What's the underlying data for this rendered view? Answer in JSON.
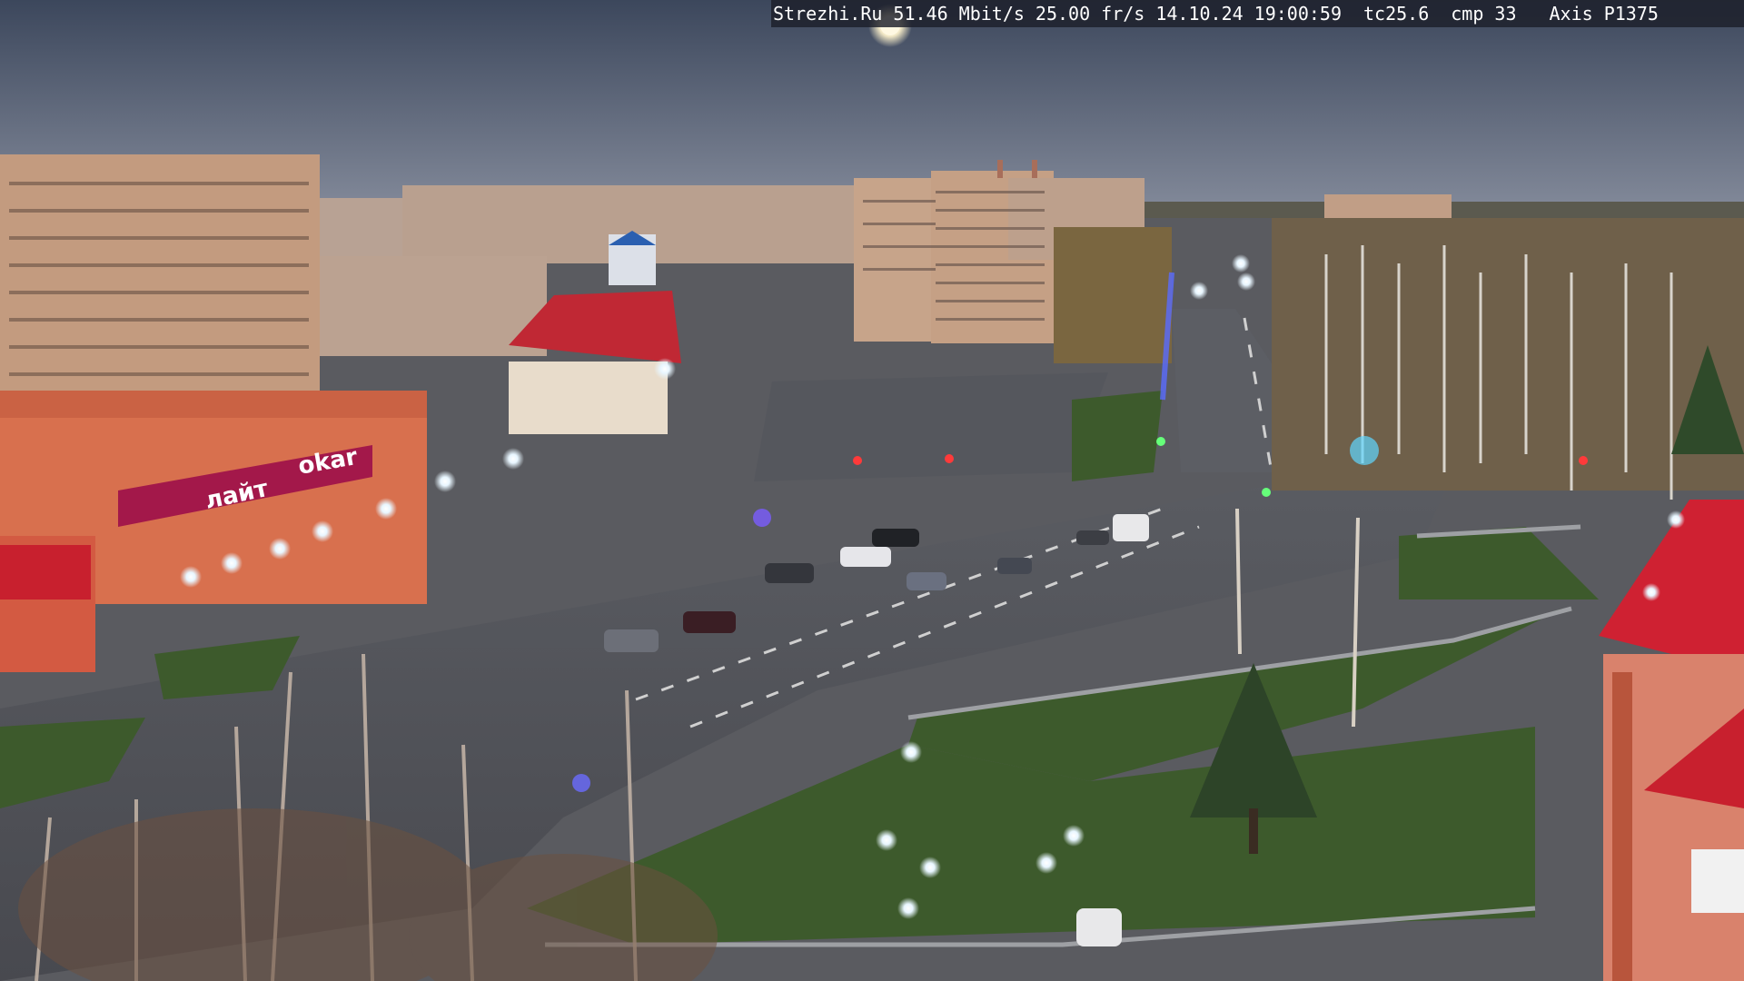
{
  "osd": {
    "site": "Strezhi.Ru",
    "bitrate": "51.46 Mbit/s",
    "framerate": "25.00 fr/s",
    "date": "14.10.24",
    "time": "19:00:59",
    "tc": "tc25.6",
    "cmp": "cmp 33",
    "camera_model": "Axis P1375"
  },
  "signs": {
    "store_main": "лайт",
    "store_right": "okar"
  },
  "colors": {
    "sky_top": "#3f4a5f",
    "sky_bottom": "#7d8699",
    "asphalt": "#4c4e55",
    "grass": "#3d5a2c",
    "brick": "#c59a7e",
    "red_roof": "#c8202e"
  }
}
